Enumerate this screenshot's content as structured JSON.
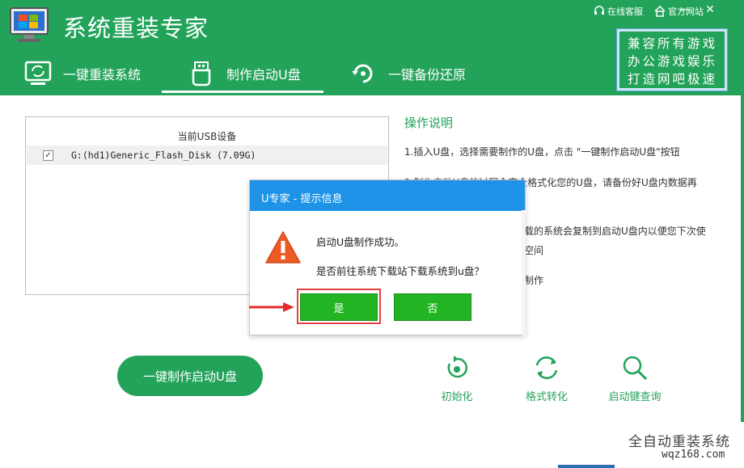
{
  "app": {
    "title": "系统重装专家",
    "logo_icon": "monitor-windows-icon"
  },
  "top_links": [
    {
      "label": "在线客服",
      "icon": "headset-icon"
    },
    {
      "label": "官方网站",
      "icon": "home-icon"
    }
  ],
  "window_controls": {
    "minimize": "—",
    "close": "✕"
  },
  "nav_tabs": [
    {
      "label": "一键重装系统",
      "icon": "monitor-refresh-icon",
      "active": false
    },
    {
      "label": "制作启动U盘",
      "icon": "usb-drive-icon",
      "active": true
    },
    {
      "label": "一键备份还原",
      "icon": "backup-restore-icon",
      "active": false
    }
  ],
  "promo": {
    "lines": [
      "兼容所有游戏",
      "办公游戏娱乐",
      "打造网吧极速"
    ]
  },
  "device_panel": {
    "header": "当前USB设备",
    "devices": [
      {
        "name": "G:(hd1)Generic_Flash_Disk (7.09G)",
        "checked": "✓"
      }
    ]
  },
  "instructions": {
    "title": "操作说明",
    "lines": [
      "1.插入U盘，选择需要制作的U盘，点击 \"一键制作启动U盘\"按钮",
      "2.制作启动U盘的过程会完全格式化您的U盘，请备份好U盘内数据再",
      "载的系统会复制到启动U盘内以便您下次使",
      "空间",
      "制作"
    ]
  },
  "make_button": {
    "label": "一键制作启动U盘"
  },
  "tools": [
    {
      "label": "初始化",
      "icon": "init-icon"
    },
    {
      "label": "格式转化",
      "icon": "convert-icon"
    },
    {
      "label": "启动键查询",
      "icon": "search-icon"
    }
  ],
  "dialog": {
    "title": "U专家 - 提示信息",
    "message1": "启动U盘制作成功。",
    "message2": "是否前往系统下载站下载系统到u盘？",
    "yes_label": "是",
    "no_label": "否",
    "icon": "warning-icon"
  },
  "watermark": {
    "line1": "全自动重装系统",
    "line2": "wqz168.com"
  },
  "colors": {
    "brand_green": "#23a35a",
    "dialog_blue": "#1e93e8",
    "button_green": "#22b422",
    "highlight_red": "#e34040"
  }
}
